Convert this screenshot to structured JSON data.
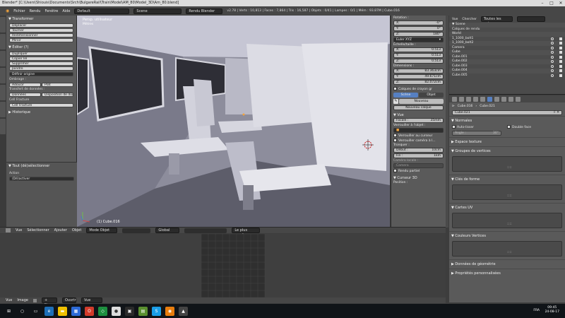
{
  "window": {
    "title": "Blender* [C:\\Users\\Shiouis\\Documents\\Srch\\BulgareRail\\Train\\Model\\AM_80\\Model_3D\\Am_80.blend]"
  },
  "menu": {
    "items": [
      "Fichier",
      "Rendu",
      "Fenêtre",
      "Aide"
    ],
    "layout": "Default",
    "scene": "Scene",
    "engine": "Rendu Blender",
    "stats": "v2.78 | Verts : 10,813 | Faces : 7,864 | Tris : 16,587 | Objets : 0/41 | Lampes : 0/1 | Mém : 93.87M | Cube.016"
  },
  "left_panel": {
    "transform_title": "▼ Transformer",
    "transform_buttons": [
      "Déplacer",
      "Tourner",
      "Redimensionner",
      "Miroir"
    ],
    "edit_title": "▼ Éditer (?)",
    "edit_buttons": [
      "Dupliquer",
      "Copier lié",
      "Supprimer",
      "Joindre"
    ],
    "set_origin": "Définir origine",
    "shading_title": "Ombrage :",
    "shading_buttons": [
      "Adoucir",
      "Plat"
    ],
    "data_transfer_title": "Transfert de données :",
    "data_buttons": [
      "Données",
      "Disposition de don..."
    ],
    "cell_fracture_1": "Cell Fracture",
    "cell_fracture_2": "Cell Fracture",
    "history_title": "▶ Historique",
    "toggle_title": "▼ Tout (dé)sélectionner",
    "action_label": "Action",
    "action_value": "(Dé)activer"
  },
  "viewport": {
    "view_label": "Persp. utilisateur",
    "unit_label": "Mètres",
    "object_label": "(1) Cube.016"
  },
  "npanel": {
    "rotation_title": "Rotation :",
    "rot_x": "-0°",
    "rot_y": "0°",
    "rot_z": "180°",
    "rotation_mode": "Euler XYZ",
    "scale_title": "Échelle/taille :",
    "scale_x": "0.513",
    "scale_y": "0.513",
    "scale_z": "0.513",
    "dimensions_title": "Dimensions :",
    "dim_x": "83.363cm",
    "dim_y": "49.671cm",
    "dim_z": "82.072cm",
    "layers_title": "Calques de crayon gr",
    "scene_tab": "Scène",
    "object_tab": "Objet",
    "new_button": "Nouveau",
    "new_layer_button": "Nouveau calque",
    "view_title": "▼ Vue",
    "lens_label": "Focale :",
    "lens_value": "35mm",
    "lock_label": "Verrouiller à l'objet :",
    "lock_cursor": "Verrouiller au curseur",
    "lock_camera": "Verrouiller caméra à l...",
    "clip_title": "Tronquer :",
    "clip_start_label": "Début :",
    "clip_start": "10cm",
    "clip_end_label": "Fin :",
    "clip_end": "1km",
    "local_camera_title": "Caméra locale :",
    "camera_value": "Camera",
    "render_border": "Rendu partiel",
    "cursor_title": "▼ Curseur 3D",
    "position_title": "Position :"
  },
  "outliner": {
    "view_label": "Vue",
    "search_label": "Chercher",
    "filter_value": "Toutes les scènes",
    "rows": [
      "▼ Scene",
      "   Calques de rendu",
      "   World",
      "   1_1000_bolt1",
      "   1_1000_bolt2",
      "   Camera",
      "   Cube",
      "   Cube.001",
      "   Cube.002",
      "   Cube.003",
      "   Cube.004",
      "   Cube.005"
    ]
  },
  "properties": {
    "breadcrumb_1": "Cube.016",
    "breadcrumb_2": "Cube.021",
    "mesh_name": "Cube.021",
    "normals_title": "▼ Normales",
    "autosmooth_label": "Auto-lisser",
    "double_sided_label": "Double face",
    "angle_label": "Angle :",
    "angle_value": "30°",
    "texture_space_title": "▶ Espace texture",
    "vertex_groups_title": "▼ Groupes de vertices",
    "shape_keys_title": "▼ Clés de forme",
    "uv_maps_title": "▼ Cartes UV",
    "vertex_colors_title": "▼ Couleurs Vertices",
    "geometry_data_title": "▶ Données de géométrie",
    "custom_props_title": "▶ Propriétés personnalisées"
  },
  "viewport_header": {
    "items": [
      "Vue",
      "Sélectionner",
      "Ajouter",
      "Objet"
    ],
    "mode": "Mode Objet",
    "pivot": "Global",
    "snap": "Le plus proche"
  },
  "uv_header": {
    "items": [
      "Vue",
      "Image"
    ],
    "new_button": "+ Nouveau",
    "open_button": "Ouvrir",
    "view_select": "Vue"
  },
  "taskbar": {
    "lang": "FRA",
    "time": "09:45",
    "date": "24-08-17"
  },
  "colors": {
    "panel": "#5a5a5a",
    "viewport": "#8d8d9c",
    "active_blue": "#5680c2",
    "orange": "#f2a33c"
  }
}
